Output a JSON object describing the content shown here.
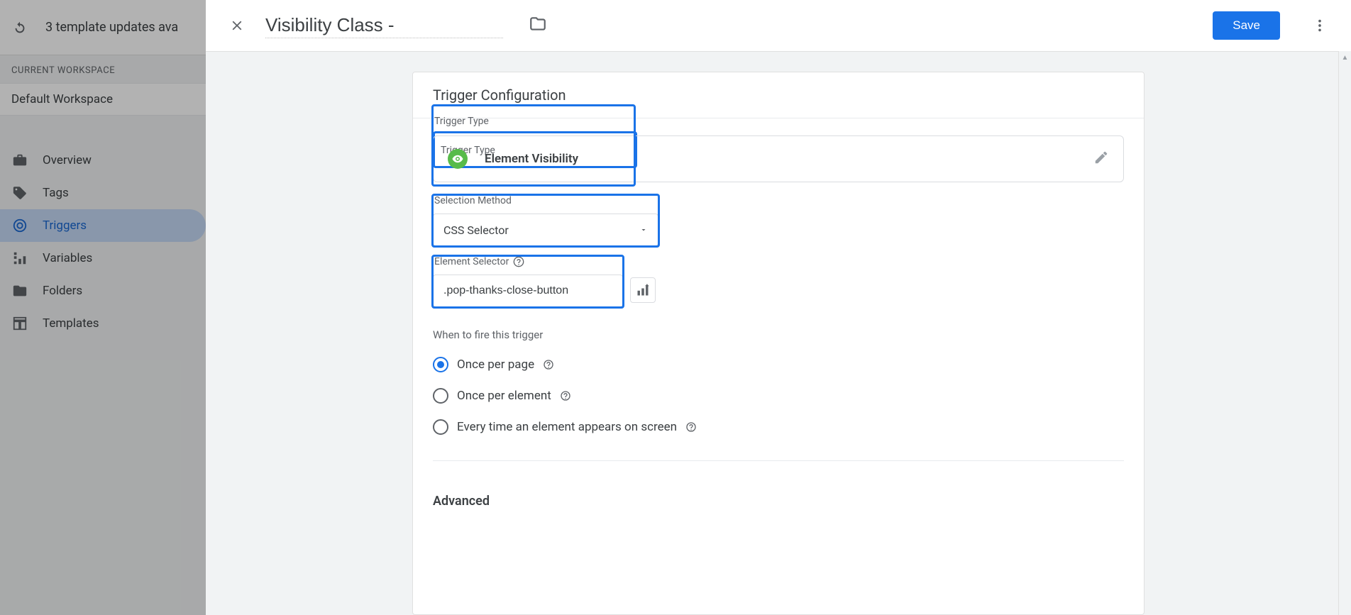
{
  "topBanner": {
    "text": "3 template updates ava"
  },
  "workspace": {
    "label": "CURRENT WORKSPACE",
    "name": "Default Workspace"
  },
  "sidebar": {
    "items": [
      {
        "label": "Overview"
      },
      {
        "label": "Tags"
      },
      {
        "label": "Triggers"
      },
      {
        "label": "Variables"
      },
      {
        "label": "Folders"
      },
      {
        "label": "Templates"
      }
    ]
  },
  "panel": {
    "title": "Visibility Class -",
    "saveLabel": "Save",
    "cardTitle": "Trigger Configuration",
    "triggerTypeLabel": "Trigger Type",
    "triggerTypeValue": "Element Visibility",
    "selectionMethodLabel": "Selection Method",
    "selectionMethodValue": "CSS Selector",
    "elementSelectorLabel": "Element Selector",
    "elementSelectorValue": ".pop-thanks-close-button",
    "fireLabel": "When to fire this trigger",
    "fireOptions": [
      {
        "label": "Once per page",
        "checked": true
      },
      {
        "label": "Once per element",
        "checked": false
      },
      {
        "label": "Every time an element appears on screen",
        "checked": false
      }
    ],
    "advancedLabel": "Advanced"
  }
}
